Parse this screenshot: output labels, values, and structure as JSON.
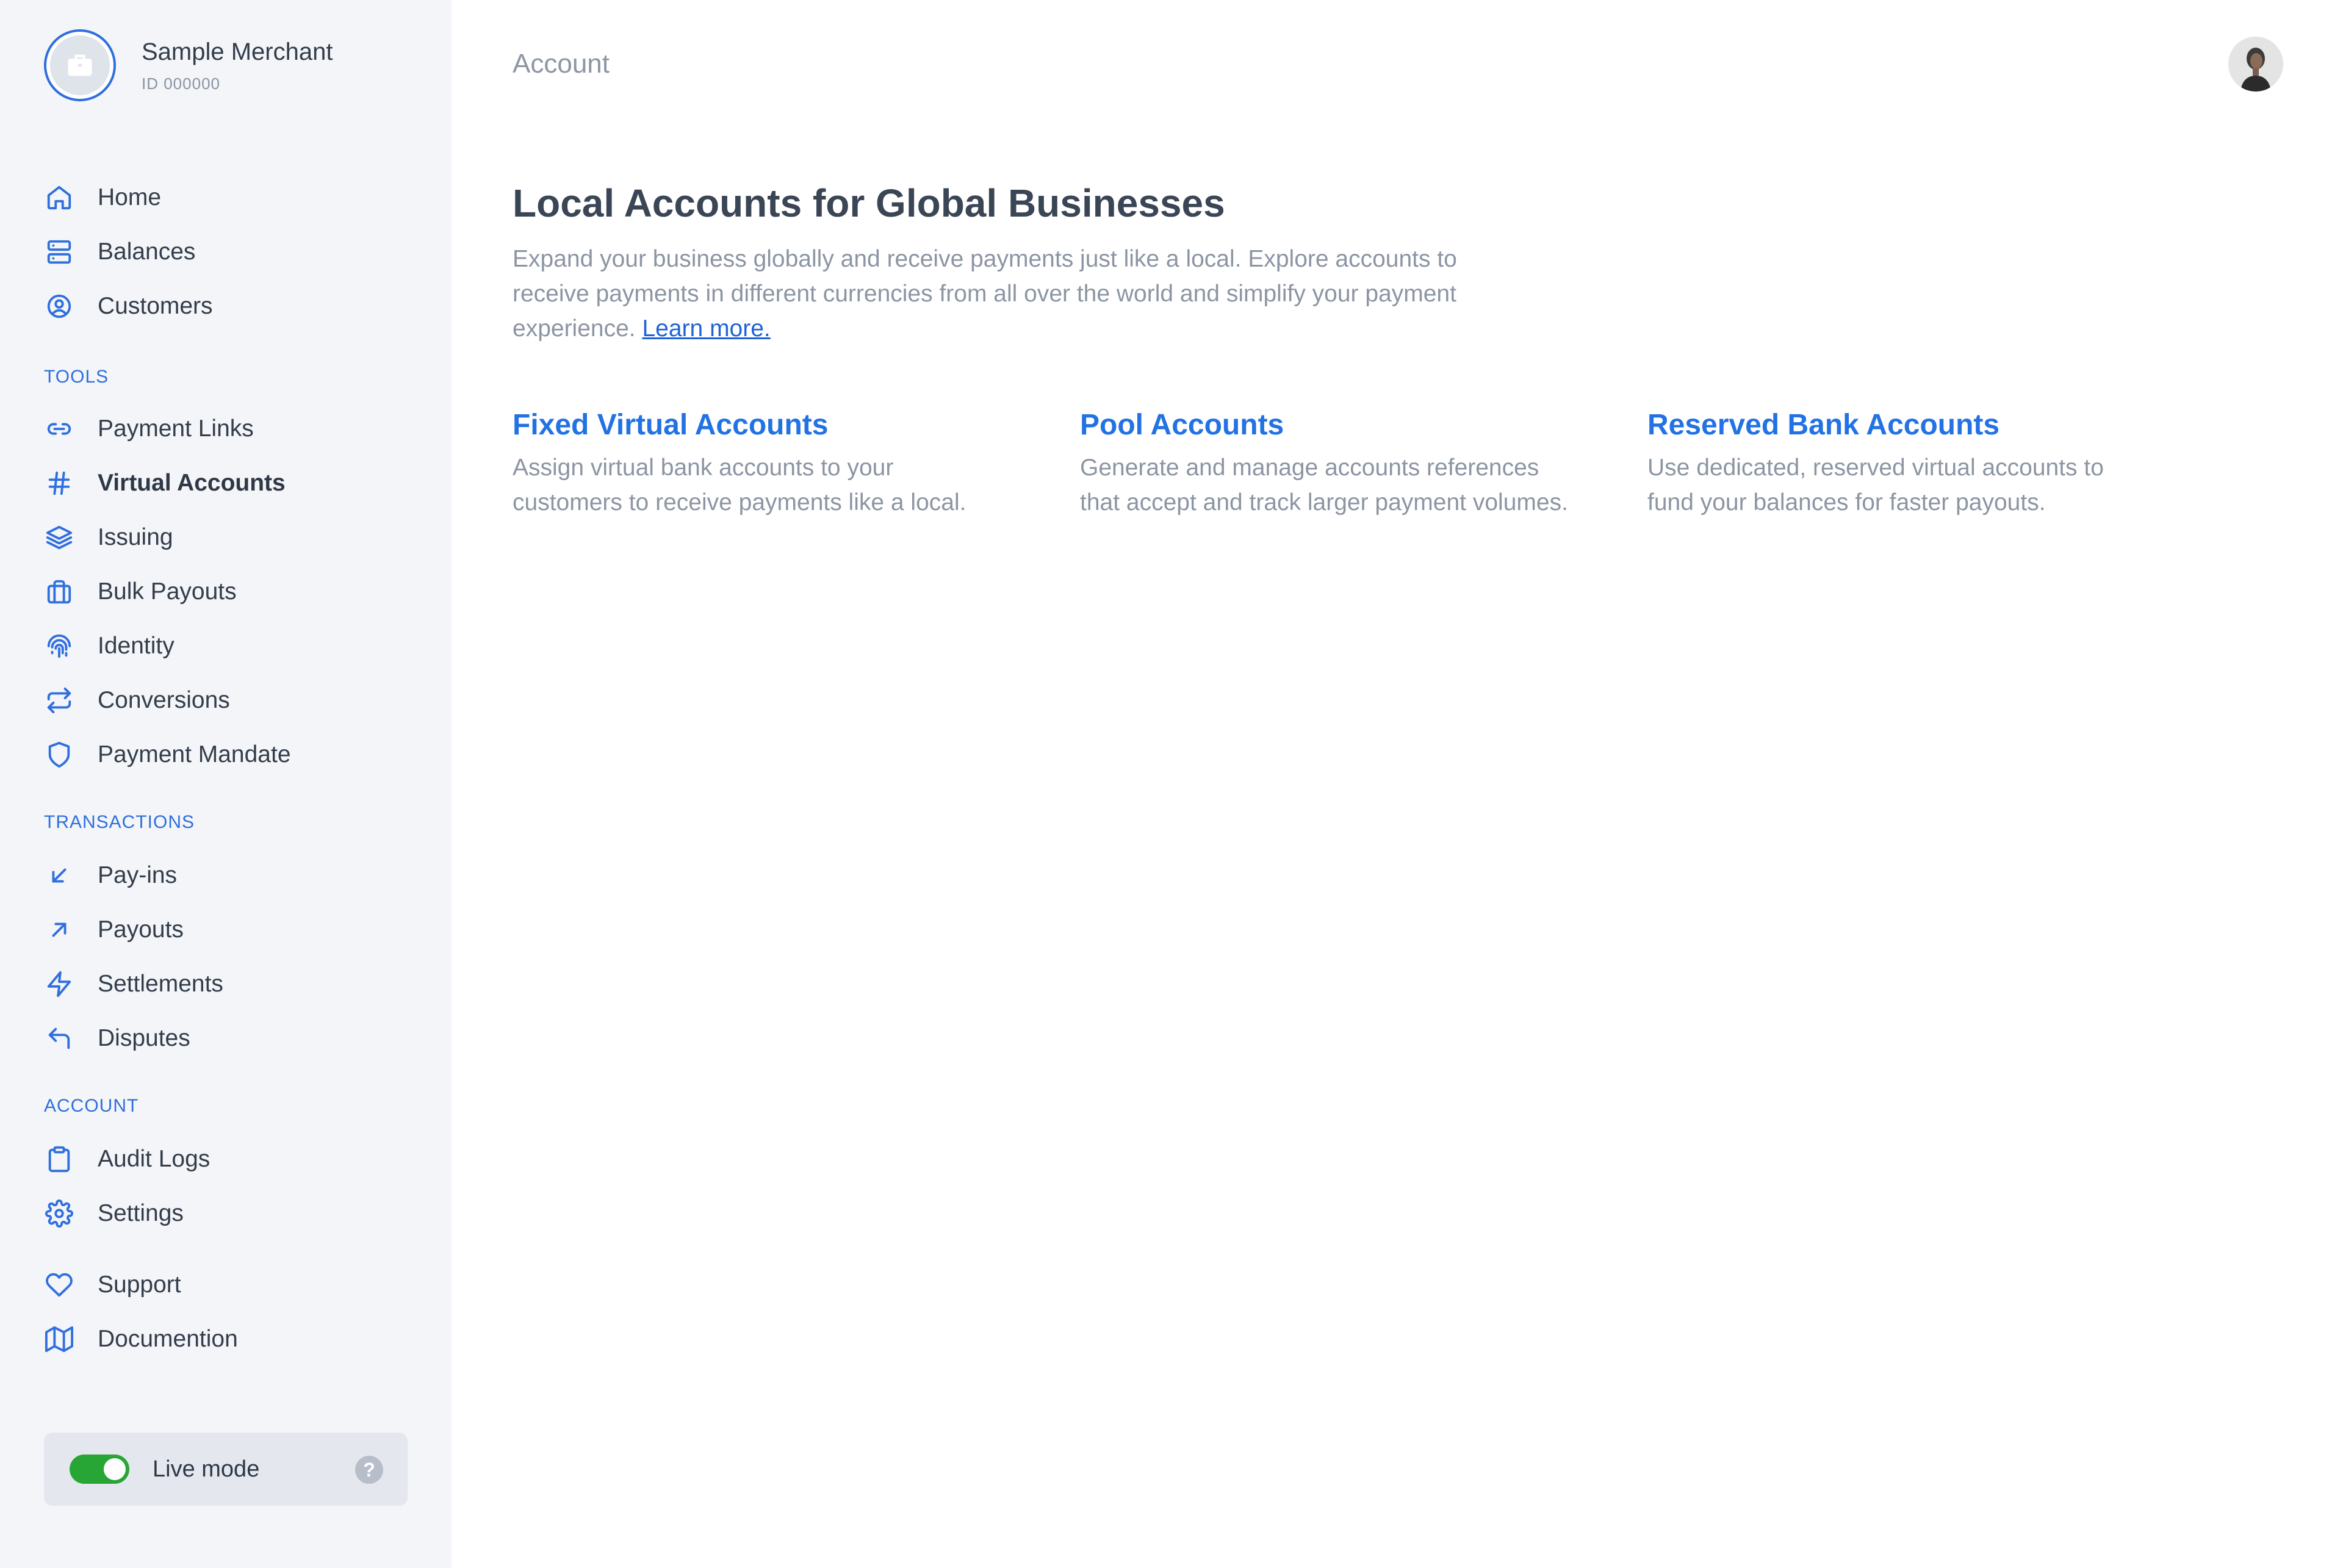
{
  "merchant": {
    "name": "Sample Merchant",
    "id": "ID  000000"
  },
  "sidebar": {
    "main_items": [
      {
        "label": "Home",
        "icon": "home-icon"
      },
      {
        "label": "Balances",
        "icon": "server-icon"
      },
      {
        "label": "Customers",
        "icon": "user-circle-icon"
      }
    ],
    "tools_label": "TOOLS",
    "tools_items": [
      {
        "label": "Payment Links",
        "icon": "link-icon"
      },
      {
        "label": "Virtual Accounts",
        "icon": "hash-icon",
        "active": true
      },
      {
        "label": "Issuing",
        "icon": "layers-icon"
      },
      {
        "label": "Bulk Payouts",
        "icon": "briefcase-icon"
      },
      {
        "label": "Identity",
        "icon": "fingerprint-icon"
      },
      {
        "label": "Conversions",
        "icon": "repeat-icon"
      },
      {
        "label": "Payment Mandate",
        "icon": "shield-icon"
      }
    ],
    "transactions_label": "TRANSACTIONS",
    "transactions_items": [
      {
        "label": "Pay-ins",
        "icon": "arrow-down-left-icon"
      },
      {
        "label": "Payouts",
        "icon": "arrow-up-right-icon"
      },
      {
        "label": "Settlements",
        "icon": "zap-icon"
      },
      {
        "label": "Disputes",
        "icon": "corner-up-left-icon"
      }
    ],
    "account_label": "ACCOUNT",
    "account_items": [
      {
        "label": "Audit Logs",
        "icon": "clipboard-icon"
      },
      {
        "label": "Settings",
        "icon": "gear-icon"
      }
    ],
    "footer_items": [
      {
        "label": "Support",
        "icon": "heart-icon"
      },
      {
        "label": "Documention",
        "icon": "map-icon"
      }
    ],
    "live_mode": {
      "label": "Live mode",
      "enabled": true,
      "help_glyph": "?"
    }
  },
  "header": {
    "title": "Account"
  },
  "hero": {
    "title": "Local Accounts for Global Businesses",
    "description": "Expand your business globally and receive payments just like a local. Explore accounts to receive payments in different currencies from all over the world and simplify your payment experience.",
    "link_label": "Learn more."
  },
  "cards": [
    {
      "title": "Fixed Virtual Accounts",
      "description": "Assign virtual bank accounts to your customers to receive payments like a local."
    },
    {
      "title": "Pool Accounts",
      "description": "Generate and manage accounts references that accept and track larger payment volumes."
    },
    {
      "title": "Reserved Bank Accounts",
      "description": "Use dedicated, reserved virtual accounts to fund your balances for faster payouts."
    }
  ],
  "colors": {
    "accent": "#2f6fde",
    "link": "#2372e4",
    "toggle_on": "#27a636",
    "sidebar_bg": "#f4f5f8"
  }
}
